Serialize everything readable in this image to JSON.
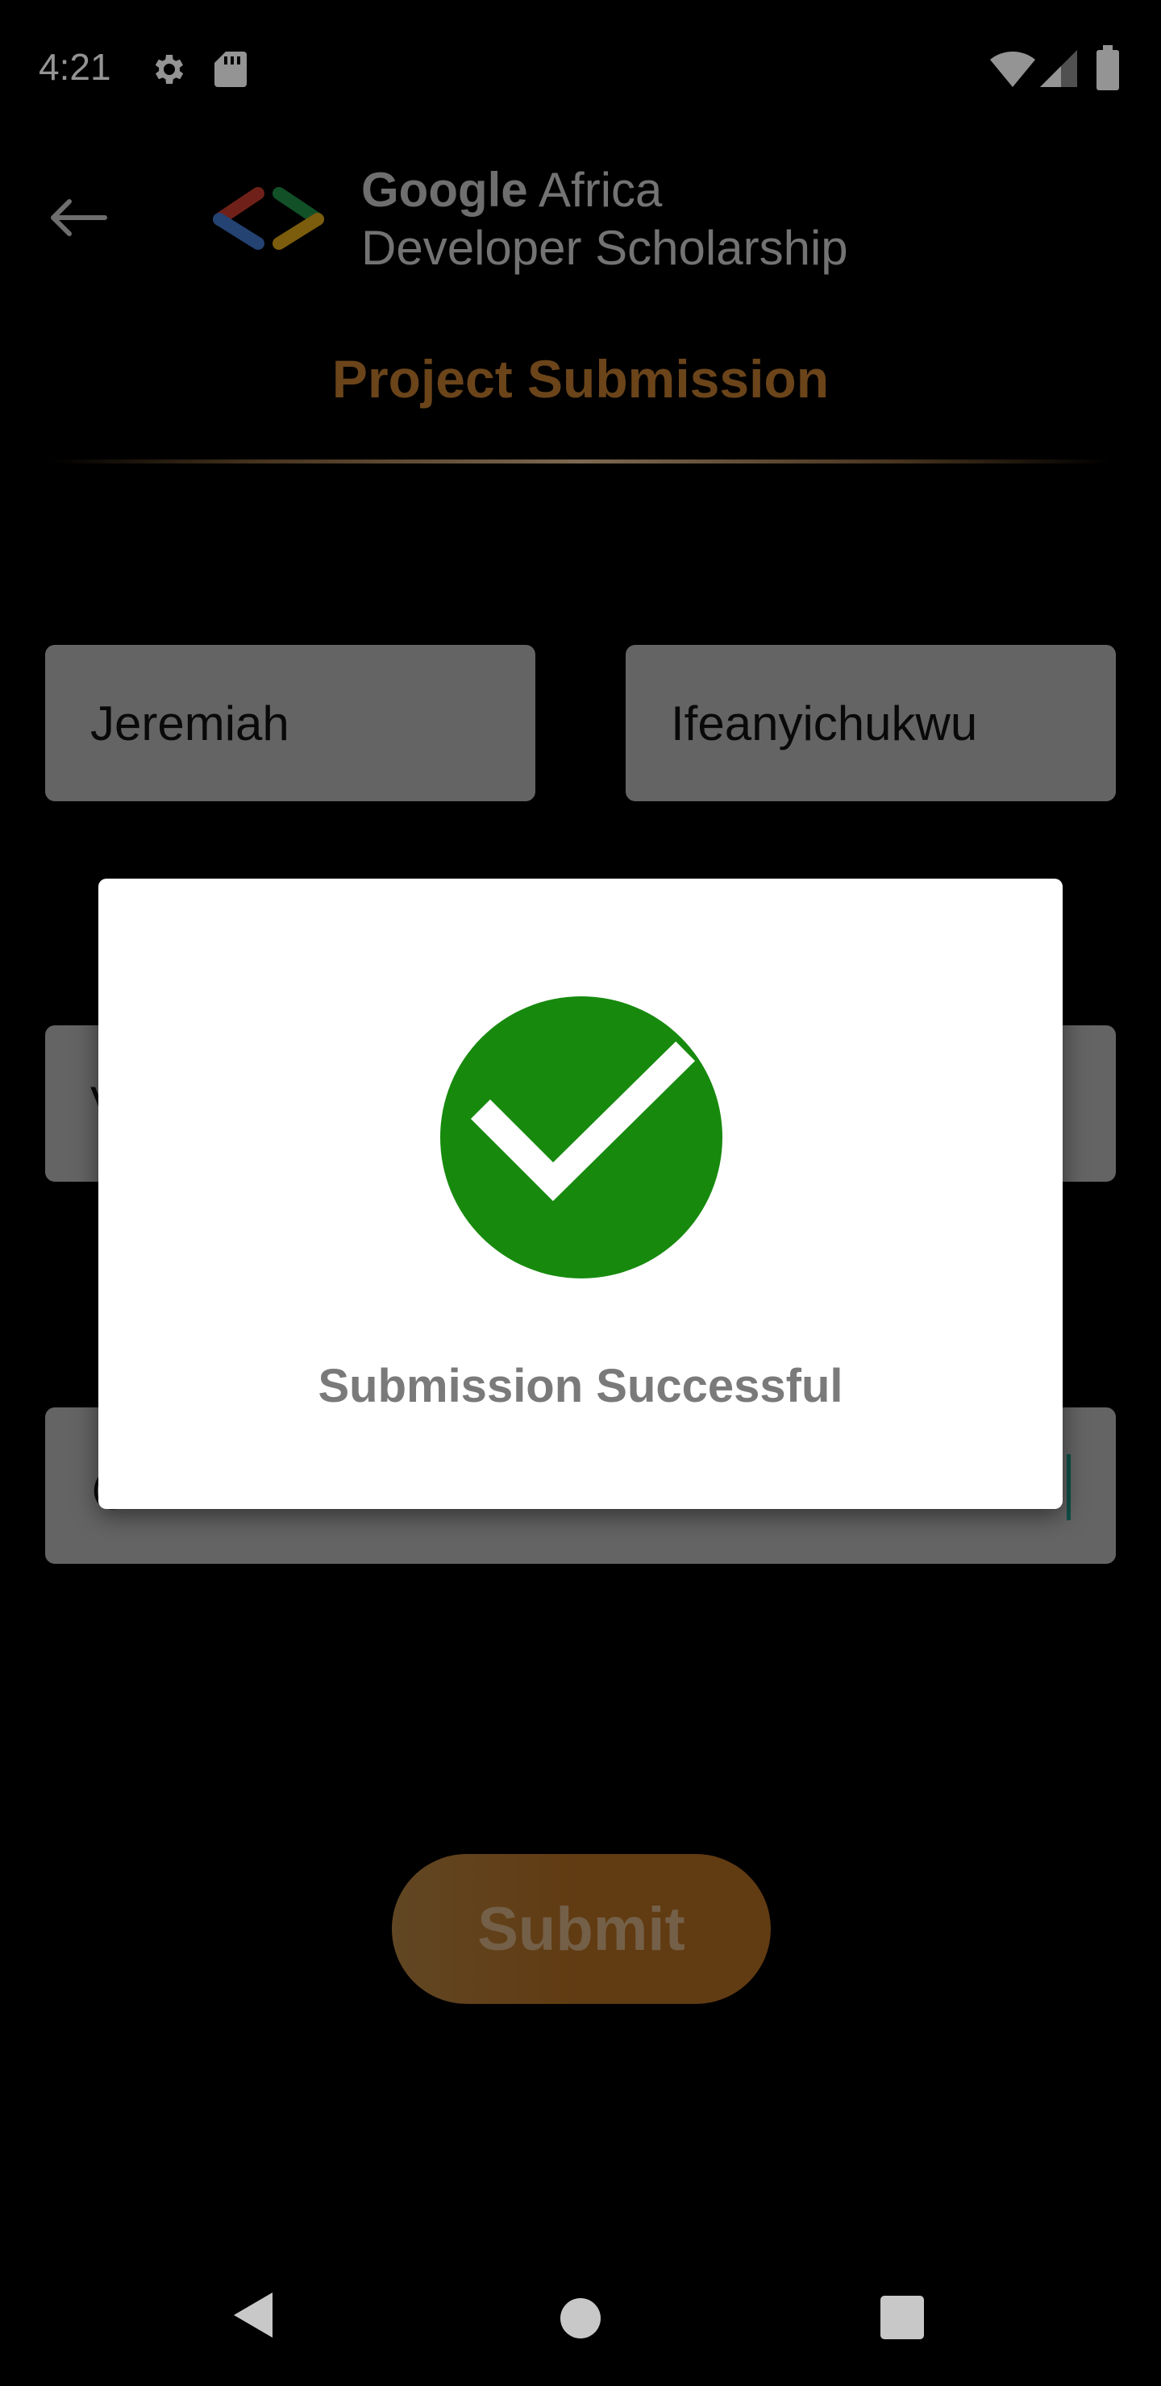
{
  "status_bar": {
    "time": "4:21",
    "icons": [
      "settings-icon",
      "sd-card-icon",
      "wifi-icon",
      "signal-icon",
      "battery-icon"
    ]
  },
  "header": {
    "back_icon": "arrow-back-icon",
    "logo_icon": "developers-logo-icon",
    "brand_bold": "Google",
    "brand_rest": "Africa",
    "brand_line2": "Developer Scholarship",
    "title": "Project Submission"
  },
  "form": {
    "first_name": "Jeremiah",
    "last_name": "Ifeanyichukwu",
    "email_partial": "V",
    "link_partial": "@"
  },
  "dialog": {
    "icon": "check-circle-icon",
    "message": "Submission Successful"
  },
  "submit_label": "Submit",
  "nav_bar": [
    "back-triangle-icon",
    "home-circle-icon",
    "recents-square-icon"
  ],
  "colors": {
    "accent": "#b9762e",
    "field_bg": "#acacac",
    "success": "#178a0e",
    "button": "#a8661f"
  }
}
